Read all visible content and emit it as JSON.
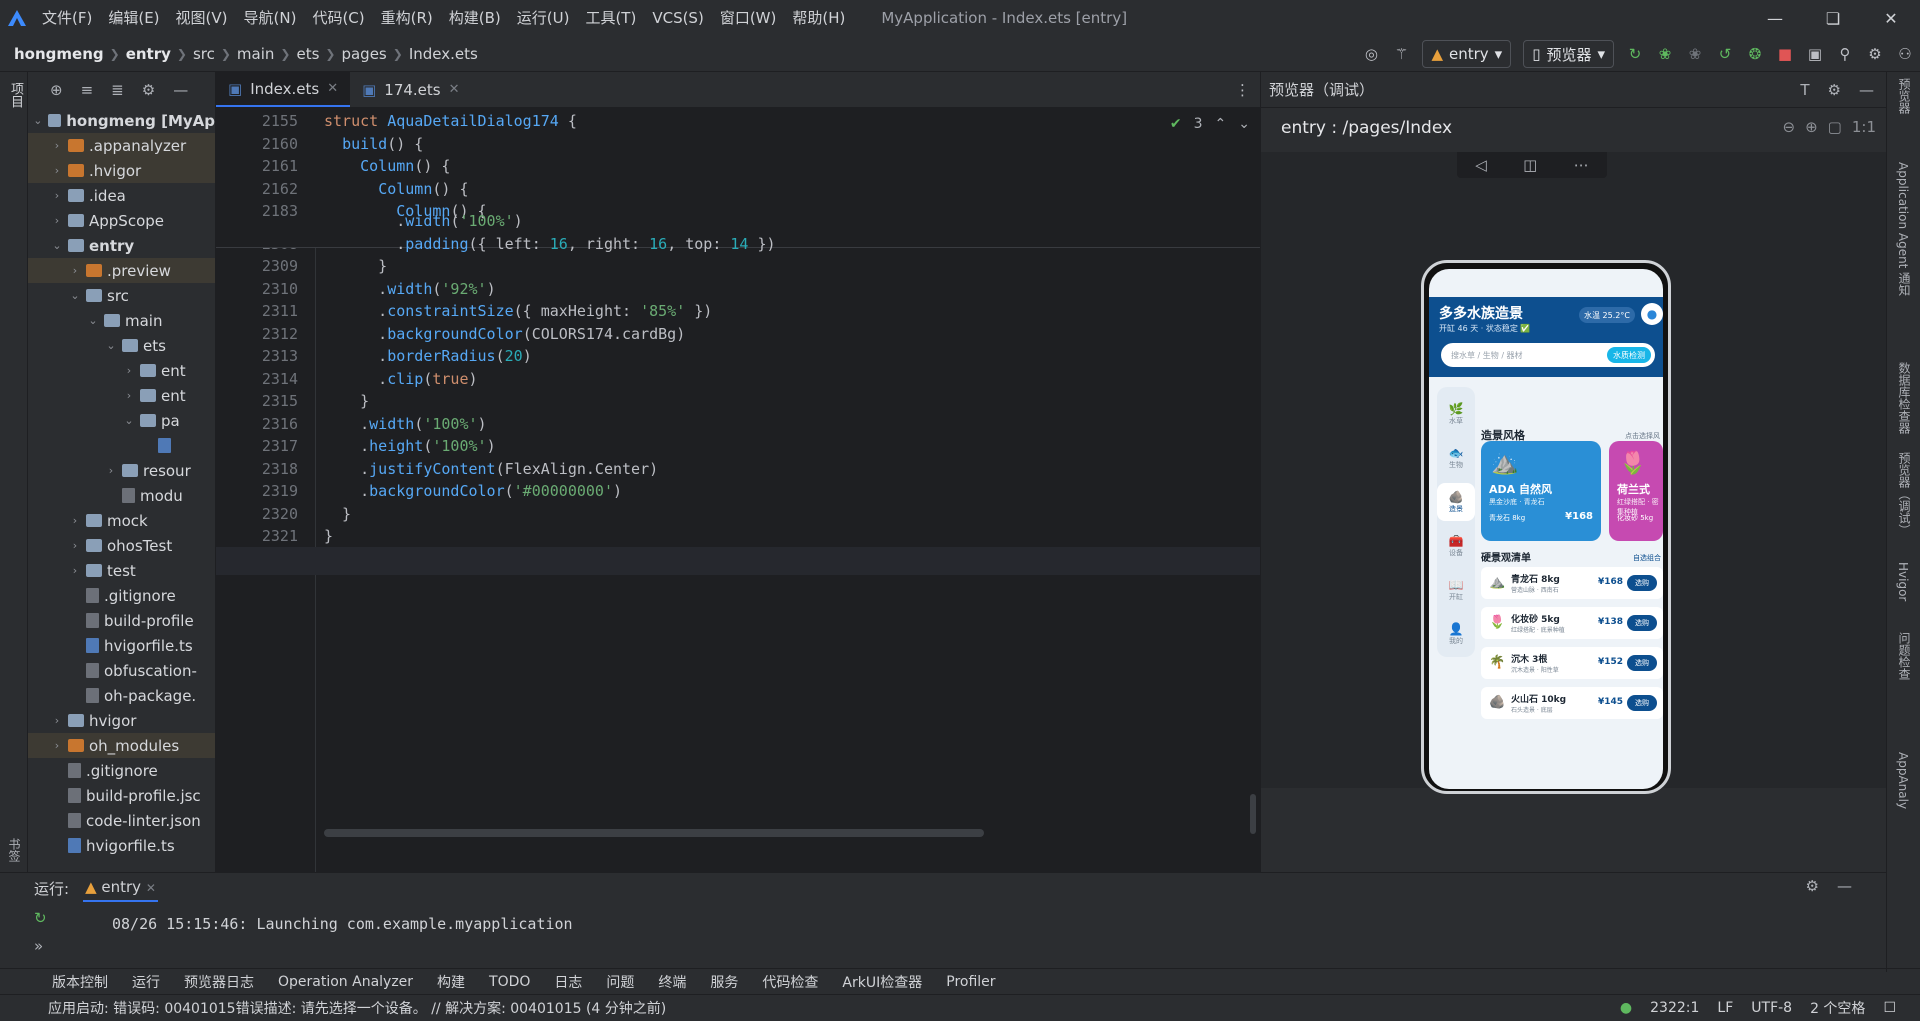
{
  "menu": [
    "文件(F)",
    "编辑(E)",
    "视图(V)",
    "导航(N)",
    "代码(C)",
    "重构(R)",
    "构建(B)",
    "运行(U)",
    "工具(T)",
    "VCS(S)",
    "窗口(W)",
    "帮助(H)"
  ],
  "window_title": "MyApplication - Index.ets [entry]",
  "breadcrumbs": [
    "hongmeng",
    "entry",
    "src",
    "main",
    "ets",
    "pages",
    "Index.ets"
  ],
  "toolbar": {
    "module": "entry",
    "device": "预览器"
  },
  "left_strip": {
    "project": "项目",
    "bookmarks": "书签",
    "structure": "结构"
  },
  "project_tree": [
    {
      "indent": 0,
      "chev": "v",
      "icon": "folder",
      "label": "hongmeng [MyAp",
      "bold": true,
      "sel": false,
      "hl": ""
    },
    {
      "indent": 1,
      "chev": ">",
      "icon": "orange",
      "label": ".appanalyzer",
      "hl": "orange"
    },
    {
      "indent": 1,
      "chev": ">",
      "icon": "orange",
      "label": ".hvigor",
      "hl": "orange"
    },
    {
      "indent": 1,
      "chev": ">",
      "icon": "folder",
      "label": ".idea",
      "hl": ""
    },
    {
      "indent": 1,
      "chev": ">",
      "icon": "folder",
      "label": "AppScope",
      "hl": ""
    },
    {
      "indent": 1,
      "chev": "v",
      "icon": "folder",
      "label": "entry",
      "bold": true,
      "hl": ""
    },
    {
      "indent": 2,
      "chev": ">",
      "icon": "orange",
      "label": ".preview",
      "hl": "orange"
    },
    {
      "indent": 2,
      "chev": "v",
      "icon": "folder",
      "label": "src",
      "hl": ""
    },
    {
      "indent": 3,
      "chev": "v",
      "icon": "folder",
      "label": "main",
      "hl": ""
    },
    {
      "indent": 4,
      "chev": "v",
      "icon": "folder",
      "label": "ets",
      "hl": ""
    },
    {
      "indent": 5,
      "chev": ">",
      "icon": "folder",
      "label": "ent",
      "hl": ""
    },
    {
      "indent": 5,
      "chev": ">",
      "icon": "folder",
      "label": "ent",
      "hl": ""
    },
    {
      "indent": 5,
      "chev": "v",
      "icon": "folder",
      "label": "pa",
      "hl": ""
    },
    {
      "indent": 6,
      "chev": "",
      "icon": "ts",
      "label": "",
      "hl": ""
    },
    {
      "indent": 4,
      "chev": ">",
      "icon": "folder",
      "label": "resour",
      "hl": ""
    },
    {
      "indent": 4,
      "chev": "",
      "icon": "file",
      "label": "modu",
      "hl": ""
    },
    {
      "indent": 2,
      "chev": ">",
      "icon": "folder",
      "label": "mock",
      "hl": ""
    },
    {
      "indent": 2,
      "chev": ">",
      "icon": "folder",
      "label": "ohosTest",
      "hl": ""
    },
    {
      "indent": 2,
      "chev": ">",
      "icon": "folder",
      "label": "test",
      "hl": ""
    },
    {
      "indent": 2,
      "chev": "",
      "icon": "file",
      "label": ".gitignore",
      "hl": ""
    },
    {
      "indent": 2,
      "chev": "",
      "icon": "file",
      "label": "build-profile",
      "hl": ""
    },
    {
      "indent": 2,
      "chev": "",
      "icon": "ts",
      "label": "hvigorfile.ts",
      "hl": ""
    },
    {
      "indent": 2,
      "chev": "",
      "icon": "file",
      "label": "obfuscation-",
      "hl": ""
    },
    {
      "indent": 2,
      "chev": "",
      "icon": "file",
      "label": "oh-package.",
      "hl": ""
    },
    {
      "indent": 1,
      "chev": ">",
      "icon": "folder",
      "label": "hvigor",
      "hl": ""
    },
    {
      "indent": 1,
      "chev": ">",
      "icon": "orange",
      "label": "oh_modules",
      "hl": "orange"
    },
    {
      "indent": 1,
      "chev": "",
      "icon": "file",
      "label": ".gitignore",
      "hl": ""
    },
    {
      "indent": 1,
      "chev": "",
      "icon": "file",
      "label": "build-profile.jsc",
      "hl": ""
    },
    {
      "indent": 1,
      "chev": "",
      "icon": "file",
      "label": "code-linter.json",
      "hl": ""
    },
    {
      "indent": 1,
      "chev": "",
      "icon": "ts",
      "label": "hvigorfile.ts",
      "hl": ""
    }
  ],
  "tabs": [
    {
      "label": "Index.ets",
      "active": true
    },
    {
      "label": "174.ets",
      "active": false
    }
  ],
  "inspections": "3",
  "sticky_lines": [
    {
      "n": "2155",
      "html": "<span class='kw'>struct</span> <span class='ty'>AquaDetailDialog174</span> {"
    },
    {
      "n": "2160",
      "html": "  <span class='fn'>build</span>() {"
    },
    {
      "n": "2161",
      "html": "    <span class='fn'>Column</span>() {"
    },
    {
      "n": "2162",
      "html": "      <span class='fn'>Column</span>() {"
    },
    {
      "n": "2183",
      "html": "        <span class='fn'>Column</span>() {"
    }
  ],
  "code_lines": [
    {
      "n": "2307",
      "html": "        .<span class='fn'>width</span>(<span class='str'>'100%'</span>)"
    },
    {
      "n": "2308",
      "html": "        .<span class='fn'>padding</span>({ left: <span class='num'>16</span>, right: <span class='num'>16</span>, top: <span class='num'>14</span> })"
    },
    {
      "n": "2309",
      "html": "      }"
    },
    {
      "n": "2310",
      "html": "      .<span class='fn'>width</span>(<span class='str'>'92%'</span>)"
    },
    {
      "n": "2311",
      "html": "      .<span class='fn'>constraintSize</span>({ maxHeight: <span class='str'>'85%'</span> })"
    },
    {
      "n": "2312",
      "html": "      .<span class='fn'>backgroundColor</span>(COLORS174.cardBg)"
    },
    {
      "n": "2313",
      "html": "      .<span class='fn'>borderRadius</span>(<span class='num'>20</span>)"
    },
    {
      "n": "2314",
      "html": "      .<span class='fn'>clip</span>(<span class='kw'>true</span>)"
    },
    {
      "n": "2315",
      "html": "    }"
    },
    {
      "n": "2316",
      "html": "    .<span class='fn'>width</span>(<span class='str'>'100%'</span>)"
    },
    {
      "n": "2317",
      "html": "    .<span class='fn'>height</span>(<span class='str'>'100%'</span>)"
    },
    {
      "n": "2318",
      "html": "    .<span class='fn'>justifyContent</span>(FlexAlign.Center)"
    },
    {
      "n": "2319",
      "html": "    .<span class='fn'>backgroundColor</span>(<span class='str'>'#00000000'</span>)"
    },
    {
      "n": "2320",
      "html": "  }"
    },
    {
      "n": "2321",
      "html": "}"
    },
    {
      "n": "2322",
      "html": ""
    }
  ],
  "preview": {
    "header": "预览器（调试）",
    "path": "entry : /pages/Index",
    "app": {
      "title": "多多水族造景",
      "subtitle": "开缸 46 天 · 状态稳定 ✅",
      "temp": "水温 25.2°C",
      "search_placeholder": "搜水草 / 生物 / 器材",
      "search_button": "水质检测",
      "nav": [
        {
          "icon": "🌿",
          "label": "水草"
        },
        {
          "icon": "🐟",
          "label": "生物"
        },
        {
          "icon": "🪨",
          "label": "造景",
          "on": true
        },
        {
          "icon": "🧰",
          "label": "设备"
        },
        {
          "icon": "📖",
          "label": "开缸"
        },
        {
          "icon": "👤",
          "label": "我的"
        }
      ],
      "section_style": "造景风格",
      "section_style_more": "点击选择风格",
      "cards": [
        {
          "name": "ADA 自然风",
          "sub": "黑金沙底 · 青龙石",
          "tag": "青龙石 8kg",
          "price": "¥168",
          "big": "⛰️",
          "color": "#2a8fd6"
        },
        {
          "name": "荷兰式",
          "sub": "红绿搭配 · 密集种植",
          "tag": "化妆砂 5kg",
          "price": "",
          "big": "🌷",
          "color": "#c64ab1"
        }
      ],
      "section_list": "硬景观清单",
      "section_list_more": "自选组合",
      "items": [
        {
          "icon": "⛰️",
          "name": "青龙石 8kg",
          "desc": "营造山脉 · 西南石",
          "price": "¥168",
          "btn": "选购"
        },
        {
          "icon": "🌷",
          "name": "化妆砂 5kg",
          "desc": "红绿搭配 · 底景种植",
          "price": "¥138",
          "btn": "选购"
        },
        {
          "icon": "🌴",
          "name": "沉木 3根",
          "desc": "沉木造景 · 阳性草",
          "price": "¥152",
          "btn": "选购"
        },
        {
          "icon": "🪨",
          "name": "火山石 10kg",
          "desc": "石头造景 · 底层",
          "price": "¥145",
          "btn": "选购"
        }
      ]
    }
  },
  "right_strip": [
    "预览器",
    "Application Agent",
    "通知",
    "数据库检查器",
    "预览器（调试）",
    "Hvigor",
    "问题检查",
    "AppAnaly"
  ],
  "run": {
    "label": "运行:",
    "config": "entry",
    "log": "08/26 15:15:46: Launching com.example.myapplication"
  },
  "bottom_tabs": [
    "版本控制",
    "运行",
    "预览器日志",
    "Operation Analyzer",
    "构建",
    "TODO",
    "日志",
    "问题",
    "终端",
    "服务",
    "代码检查",
    "ArkUI检查器",
    "Profiler"
  ],
  "status": {
    "message": "应用启动: 错误码: 00401015错误描述: 请先选择一个设备。 // 解决方案: 00401015 (4 分钟之前)",
    "pos": "2322:1",
    "eol": "LF",
    "enc": "UTF-8",
    "indent": "2 个空格"
  }
}
